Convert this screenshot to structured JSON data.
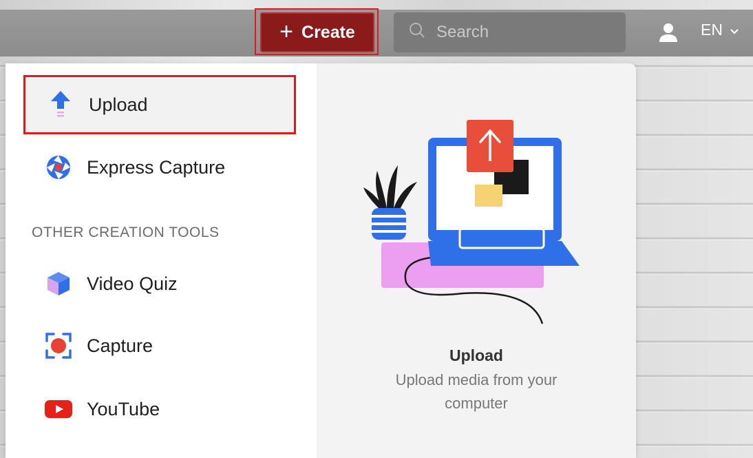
{
  "header": {
    "create_label": "Create",
    "search_placeholder": "Search",
    "language": "EN"
  },
  "menu": {
    "items": [
      {
        "label": "Upload",
        "icon": "upload-arrow-icon"
      },
      {
        "label": "Express Capture",
        "icon": "express-capture-icon"
      }
    ],
    "section_label": "OTHER CREATION TOOLS",
    "other_items": [
      {
        "label": "Video Quiz",
        "icon": "video-quiz-cube-icon"
      },
      {
        "label": "Capture",
        "icon": "capture-record-icon"
      },
      {
        "label": "YouTube",
        "icon": "youtube-icon"
      }
    ]
  },
  "preview": {
    "title": "Upload",
    "description": "Upload media from your computer"
  },
  "colors": {
    "create_button": "#8b1a1a",
    "highlight_outline": "#e01b1b",
    "accent_blue": "#2f6fe8"
  }
}
